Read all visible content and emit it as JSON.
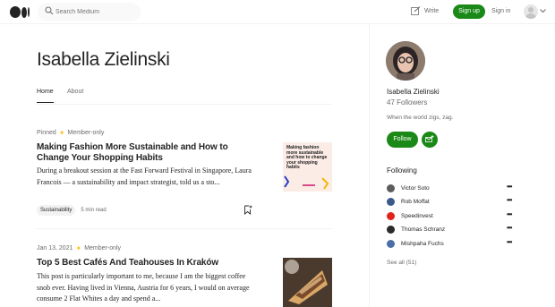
{
  "header": {
    "search_placeholder": "Search Medium",
    "write_label": "Write",
    "signup_label": "Sign up",
    "signin_label": "Sign in"
  },
  "profile": {
    "name": "Isabella Zielinski",
    "followers": "47 Followers",
    "bio": "When the world zigs, zag.",
    "follow_label": "Follow"
  },
  "tabs": [
    {
      "label": "Home",
      "active": true
    },
    {
      "label": "About",
      "active": false
    }
  ],
  "posts": [
    {
      "pinned": "Pinned",
      "member": "Member-only",
      "title": "Making Fashion More Sustainable and How to Change Your Shopping Habits",
      "excerpt": "During a breakout session at the Fast Forward Festival in Singapore, Laura Francois — a sustainability and impact strategist, told us a sto...",
      "tag": "Sustainability",
      "read_time": "5 min read",
      "thumb_text": "Making fashion more sustainable and how to change your shopping habits"
    },
    {
      "date": "Jan 13, 2021",
      "member": "Member-only",
      "title": "Top 5 Best Cafés And Teahouses In Kraków",
      "excerpt": "This post is particularly important to me, because I am the biggest coffee snob ever. Having lived in Vienna, Austria for 6 years, I would on average consume 2 Flat Whites a day and spend a..."
    }
  ],
  "following": {
    "heading": "Following",
    "see_all": "See all (51)",
    "items": [
      {
        "name": "Victor Soto",
        "color": "#5c5c5c"
      },
      {
        "name": "Rob Moffat",
        "color": "#3b5b8c"
      },
      {
        "name": "Speedinvest",
        "color": "#e2231a"
      },
      {
        "name": "Thomas Schranz",
        "color": "#2a2a2a"
      },
      {
        "name": "Mishpaha Fuchs",
        "color": "#4a6fa5"
      }
    ]
  },
  "colors": {
    "accent": "#1a8917",
    "star": "#ffc017"
  }
}
